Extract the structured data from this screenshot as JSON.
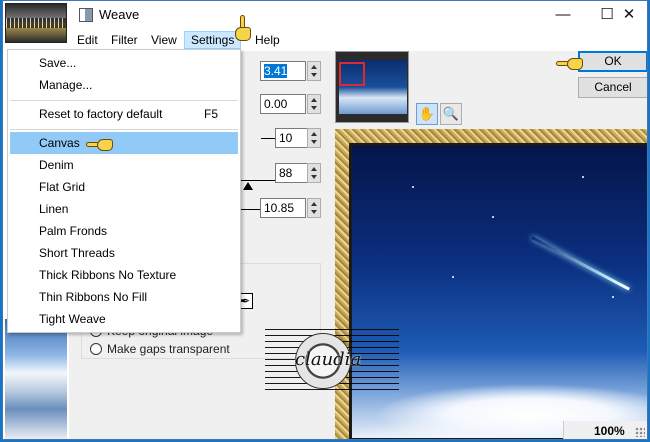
{
  "window": {
    "title": "Weave",
    "minimize_glyph": "—",
    "maximize_glyph": "☐",
    "close_glyph": "✕"
  },
  "menubar": {
    "items": [
      "Edit",
      "Filter",
      "View",
      "Settings",
      "Help"
    ],
    "active": "Settings"
  },
  "settings_menu": {
    "items": [
      {
        "label": "Save...",
        "shortcut": ""
      },
      {
        "label": "Manage...",
        "shortcut": ""
      },
      {
        "label": "Reset to factory default",
        "shortcut": "F5"
      },
      {
        "label": "Canvas",
        "shortcut": ""
      },
      {
        "label": "Denim",
        "shortcut": ""
      },
      {
        "label": "Flat Grid",
        "shortcut": ""
      },
      {
        "label": "Linen",
        "shortcut": ""
      },
      {
        "label": "Palm Fronds",
        "shortcut": ""
      },
      {
        "label": "Short Threads",
        "shortcut": ""
      },
      {
        "label": "Thick Ribbons No Texture",
        "shortcut": ""
      },
      {
        "label": "Thin Ribbons No Fill",
        "shortcut": ""
      },
      {
        "label": "Tight Weave",
        "shortcut": ""
      }
    ],
    "highlighted": "Canvas"
  },
  "fields": {
    "value_1": "3.41",
    "value_2": "0.00",
    "value_3": "10",
    "value_4": "88",
    "value_5": "10.85"
  },
  "options": {
    "keep_original_image": "Keep original image",
    "make_gaps_transparent": "Make gaps transparent"
  },
  "buttons": {
    "ok": "OK",
    "cancel": "Cancel",
    "pan_glyph": "✋",
    "zoom_glyph": "🔍",
    "picker_glyph": "✒"
  },
  "status": {
    "zoom": "100%"
  },
  "watermark": {
    "text": "claudia"
  },
  "colors": {
    "accent": "#0078d7",
    "menu_highlight": "#91c9f7",
    "selection_rect": "#e0282d"
  }
}
